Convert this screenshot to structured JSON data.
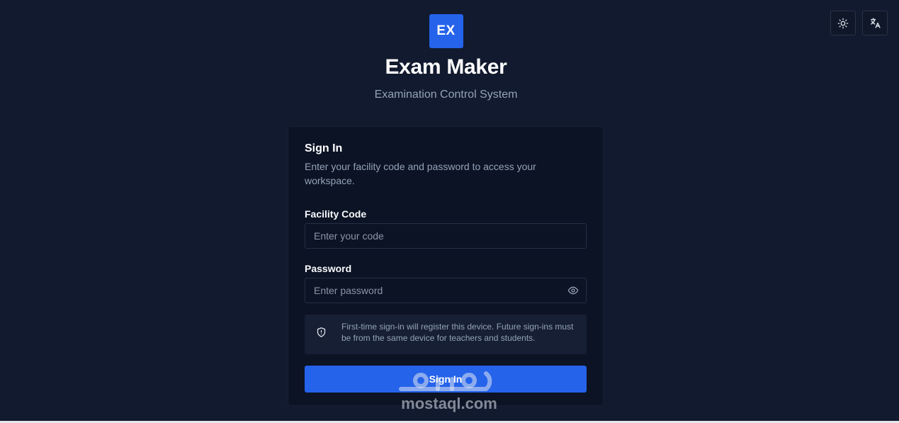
{
  "header": {
    "theme_icon": "sun-icon",
    "language_icon": "translate-icon"
  },
  "brand": {
    "logo_text": "EX",
    "title": "Exam Maker",
    "subtitle": "Examination Control System",
    "accent_color": "#2563eb"
  },
  "signin": {
    "title": "Sign In",
    "description": "Enter your facility code and password to access your workspace.",
    "facility_code": {
      "label": "Facility Code",
      "placeholder": "Enter your code",
      "value": ""
    },
    "password": {
      "label": "Password",
      "placeholder": "Enter password",
      "value": "",
      "toggle_icon": "eye-icon"
    },
    "notice": {
      "icon": "shield-alert-icon",
      "text": "First-time sign-in will register this device. Future sign-ins must be from the same device for teachers and students."
    },
    "submit_label": "Sign In"
  },
  "watermark": {
    "text": "mostaql.com"
  }
}
